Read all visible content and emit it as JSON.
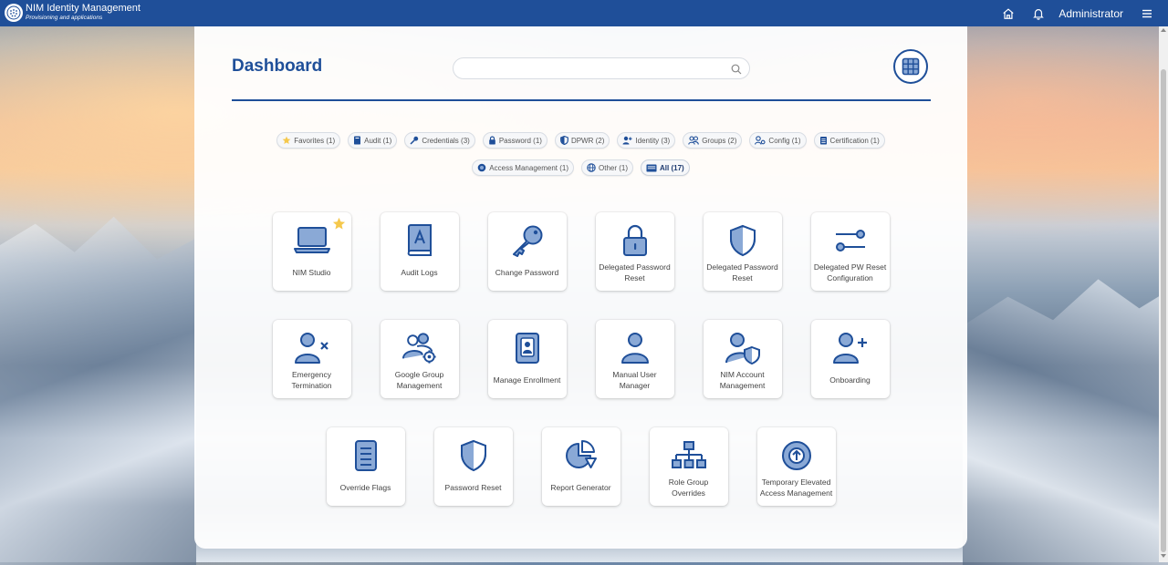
{
  "app": {
    "title": "NIM Identity Management",
    "subtitle": "Provisioning and applications",
    "user": "Administrator"
  },
  "dashboard": {
    "title": "Dashboard",
    "search": {
      "value": "",
      "placeholder": ""
    }
  },
  "filters": [
    {
      "label": "Favorites (1)",
      "icon": "star-icon"
    },
    {
      "label": "Audit (1)",
      "icon": "book-icon"
    },
    {
      "label": "Credentials (3)",
      "icon": "key-icon"
    },
    {
      "label": "Password (1)",
      "icon": "lock-icon"
    },
    {
      "label": "DPWR (2)",
      "icon": "shield-icon"
    },
    {
      "label": "Identity (3)",
      "icon": "user-plus-icon"
    },
    {
      "label": "Groups (2)",
      "icon": "users-icon"
    },
    {
      "label": "Config (1)",
      "icon": "user-gear-icon"
    },
    {
      "label": "Certification (1)",
      "icon": "clipboard-icon"
    },
    {
      "label": "Access Management (1)",
      "icon": "globe-icon"
    },
    {
      "label": "Other (1)",
      "icon": "globe-icon"
    },
    {
      "label": "All (17)",
      "icon": "list-icon",
      "active": true
    }
  ],
  "tiles": [
    {
      "label": "NIM Studio",
      "icon": "laptop-icon",
      "favorite": true
    },
    {
      "label": "Audit Logs",
      "icon": "book-icon"
    },
    {
      "label": "Change Password",
      "icon": "key-icon"
    },
    {
      "label": "Delegated Password Reset",
      "icon": "lock-icon"
    },
    {
      "label": "Delegated Password Reset",
      "icon": "shield-icon"
    },
    {
      "label": "Delegated PW Reset Configuration",
      "icon": "sliders-icon"
    },
    {
      "label": "Emergency Termination",
      "icon": "user-x-icon"
    },
    {
      "label": "Google Group Management",
      "icon": "users-gear-icon"
    },
    {
      "label": "Manage Enrollment",
      "icon": "id-badge-icon"
    },
    {
      "label": "Manual User Manager",
      "icon": "user-icon"
    },
    {
      "label": "NIM Account Management",
      "icon": "user-shield-icon"
    },
    {
      "label": "Onboarding",
      "icon": "user-plus-icon"
    },
    {
      "label": "Override Flags",
      "icon": "document-icon"
    },
    {
      "label": "Password Reset",
      "icon": "shield-icon"
    },
    {
      "label": "Report Generator",
      "icon": "pie-chart-icon"
    },
    {
      "label": "Role Group Overrides",
      "icon": "hierarchy-icon"
    },
    {
      "label": "Temporary Elevated Access Management",
      "icon": "arrow-up-circle-icon"
    }
  ],
  "colors": {
    "brand": "#1f4f99",
    "icon_fill": "#8aa9d6",
    "icon_stroke": "#1f4f99",
    "star": "#f5c84c"
  }
}
